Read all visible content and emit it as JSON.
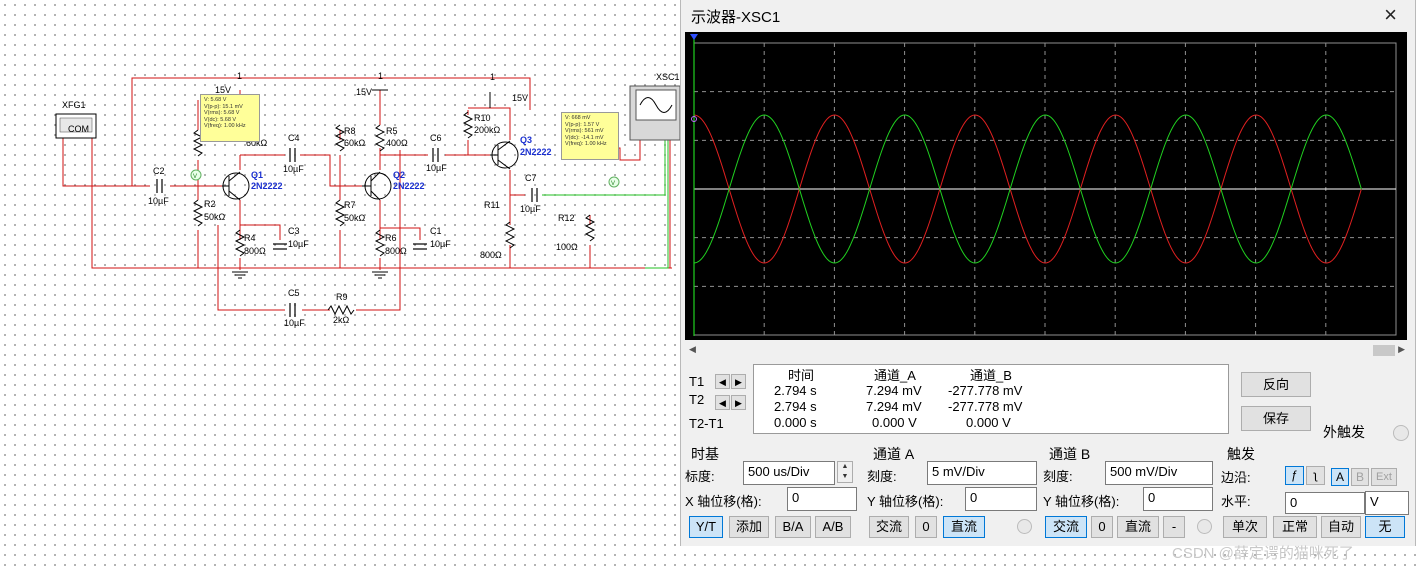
{
  "schematic": {
    "fg_label": "XFG1",
    "fg_com": "COM",
    "osc_label": "XSC1",
    "vcc": [
      "15V",
      "15V",
      "15V"
    ],
    "node_1": [
      "1",
      "1",
      "1"
    ],
    "components": {
      "C2": {
        "name": "C2",
        "value": "10µF"
      },
      "R2": {
        "name": "R2",
        "value": "50kΩ"
      },
      "Q1": {
        "name": "Q1",
        "value": "2N2222"
      },
      "R4": {
        "name": "R4",
        "value": "800Ω"
      },
      "C3": {
        "name": "C3",
        "value": "10µF"
      },
      "R1v": {
        "value": "60kΩ"
      },
      "C4": {
        "name": "C4",
        "value": "10µF"
      },
      "R8": {
        "name": "R8",
        "value": "60kΩ"
      },
      "R5": {
        "name": "R5",
        "value": "400Ω"
      },
      "Q2": {
        "name": "Q2",
        "value": "2N2222"
      },
      "R7": {
        "name": "R7",
        "value": "50kΩ"
      },
      "R6": {
        "name": "R6",
        "value": "800Ω"
      },
      "C1": {
        "name": "C1",
        "value": "10µF"
      },
      "C6": {
        "name": "C6",
        "value": "10µF"
      },
      "R10": {
        "name": "R10",
        "value": "200kΩ"
      },
      "Q3": {
        "name": "Q3",
        "value": "2N2222"
      },
      "C7": {
        "name": "C7",
        "value": "10µF"
      },
      "R11": {
        "name": "R11",
        "value": "800Ω"
      },
      "R12": {
        "name": "R12",
        "value": "100Ω"
      },
      "C5": {
        "name": "C5",
        "value": "10µF"
      },
      "R9": {
        "name": "R9",
        "value": "2kΩ"
      }
    },
    "probe1": [
      "V: 5.68 V",
      "V(p-p): 15.1 mV",
      "V(rms): 5.68 V",
      "V(dc): 5.68 V",
      "V(freq): 1.00 kHz"
    ],
    "probe2": [
      "V: 668 mV",
      "V(p-p): 1.57 V",
      "V(rms): 561 mV",
      "V(dc): -14.1 mV",
      "V(freq): 1.00 kHz"
    ],
    "probe_tags": [
      "V",
      "V"
    ]
  },
  "oscilloscope": {
    "title": "示波器-XSC1",
    "close_icon": "×",
    "colors": {
      "channel_a": "#e02020",
      "channel_b": "#20d020",
      "screen_bg": "#000000",
      "grid": "#909090"
    },
    "cursor_table": {
      "headers": [
        "时间",
        "通道_A",
        "通道_B"
      ],
      "rows": [
        {
          "label": "T1",
          "time": "2.794 s",
          "a": "7.294 mV",
          "b": "-277.778 mV"
        },
        {
          "label": "T2",
          "time": "2.794 s",
          "a": "7.294 mV",
          "b": "-277.778 mV"
        },
        {
          "label": "T2-T1",
          "time": "0.000 s",
          "a": "0.000 V",
          "b": "0.000 V"
        }
      ]
    },
    "reverse_button": "反向",
    "save_button": "保存",
    "ext_trigger_label": "外触发",
    "timebase": {
      "title": "时基",
      "scale_label": "标度:",
      "scale_value": "500 us/Div",
      "xpos_label": "X 轴位移(格):",
      "xpos_value": "0",
      "buttons": [
        "Y/T",
        "添加",
        "B/A",
        "A/B"
      ],
      "selected": "Y/T"
    },
    "channel_a": {
      "title": "通道 A",
      "scale_label": "刻度:",
      "scale_value": "5 mV/Div",
      "ypos_label": "Y 轴位移(格):",
      "ypos_value": "0",
      "buttons": [
        "交流",
        "0",
        "直流"
      ],
      "selected": "直流"
    },
    "channel_b": {
      "title": "通道 B",
      "scale_label": "刻度:",
      "scale_value": "500 mV/Div",
      "ypos_label": "Y 轴位移(格):",
      "ypos_value": "0",
      "buttons": [
        "交流",
        "0",
        "直流",
        "-"
      ],
      "selected": "交流"
    },
    "trigger": {
      "title": "触发",
      "edge_label": "边沿:",
      "edge_buttons": [
        "A",
        "B",
        "Ext"
      ],
      "level_label": "水平:",
      "level_value": "0",
      "level_unit": "V",
      "mode_buttons": [
        "单次",
        "正常",
        "自动",
        "无"
      ],
      "selected_mode": "无"
    }
  },
  "watermark": "CSDN @薛定谔的猫咪死了"
}
